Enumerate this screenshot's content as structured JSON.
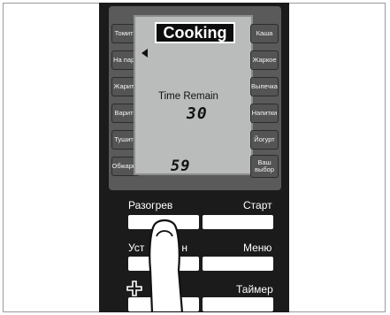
{
  "lcd": {
    "mode_badge": "Cooking",
    "time_label": "Time Remain",
    "time_big": "30",
    "time_small": "59"
  },
  "left_buttons": [
    "Томить",
    "На пару",
    "Жарить",
    "Варить",
    "Тушить",
    "Обжарка"
  ],
  "right_buttons": [
    "Каша",
    "Жаркое",
    "Выпечка",
    "Напитки",
    "Йогурт",
    "Ваш выбор"
  ],
  "controls": {
    "reheat": "Разогрев",
    "start": "Старт",
    "setup_partial": "Уст",
    "setup_tail": "н",
    "menu": "Меню",
    "timer": "Таймер"
  },
  "colors": {
    "panel": "#1b1b1b",
    "lcd": "#b9bcba",
    "button": "#545454",
    "key": "#ffffff"
  },
  "icons": [
    "arrow-left-icon",
    "plus-icon",
    "finger-icon"
  ]
}
